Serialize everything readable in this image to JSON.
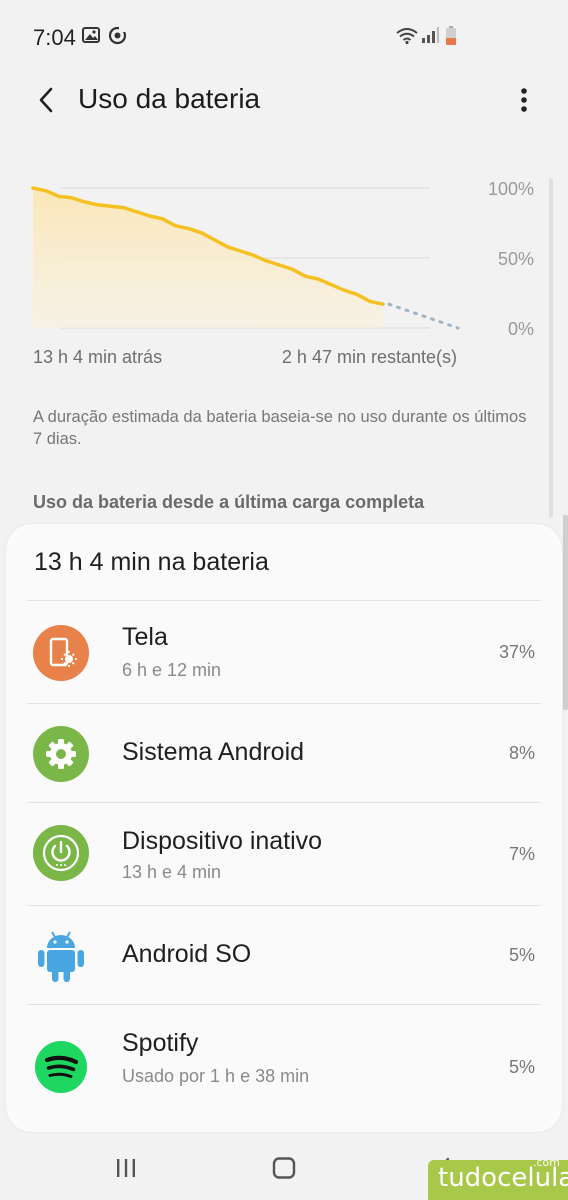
{
  "status_bar": {
    "time": "7:04",
    "icons_left": [
      "image-icon",
      "sync-icon"
    ],
    "icons_right": [
      "wifi-icon",
      "signal-icon",
      "battery-icon"
    ]
  },
  "header": {
    "title": "Uso da bateria",
    "back_icon": "back-arrow-icon",
    "menu_icon": "more-vert-icon"
  },
  "chart_data": {
    "type": "area",
    "y_ticks": [
      "100%",
      "50%",
      "0%"
    ],
    "ylim": [
      0,
      100
    ],
    "x_labels": [
      "13 h 4 min atrás",
      "2 h 47 min restante(s)"
    ],
    "series": [
      {
        "values": [
          100,
          98,
          94,
          93,
          90,
          88,
          87,
          86,
          83,
          80,
          78,
          73,
          71,
          68,
          63,
          58,
          55,
          52,
          48,
          45,
          42,
          37,
          35,
          31,
          27,
          24,
          19,
          17
        ],
        "color": "#f5c021"
      }
    ],
    "projection": {
      "start": 17,
      "end": 0,
      "color": "#9fb4c8",
      "style": "dotted"
    },
    "grid": true
  },
  "estimate_note": "A duração estimada da bateria baseia-se no uso durante os últimos 7 dias.",
  "section_header": "Uso da bateria desde a última carga completa",
  "card": {
    "title": "13 h 4 min na bateria",
    "items": [
      {
        "name": "Tela",
        "sub": "6 h e 12 min",
        "pct": "37%",
        "icon": "screen-brightness-icon",
        "color": "#e8814a"
      },
      {
        "name": "Sistema Android",
        "sub": "",
        "pct": "8%",
        "icon": "gear-icon",
        "color": "#7ab648"
      },
      {
        "name": "Dispositivo inativo",
        "sub": "13 h e 4 min",
        "pct": "7%",
        "icon": "power-icon",
        "color": "#7ab648"
      },
      {
        "name": "Android SO",
        "sub": "",
        "pct": "5%",
        "icon": "android-icon",
        "color": "#4aa6e0"
      },
      {
        "name": "Spotify",
        "sub": "Usado por 1 h e 38 min",
        "pct": "5%",
        "icon": "spotify-icon",
        "color": "#1ed760"
      }
    ]
  },
  "nav": {
    "recent_icon": "recent-apps-icon",
    "home_icon": "home-icon",
    "back_icon": "nav-back-icon"
  },
  "watermark": {
    "text": "tudocelular",
    "suffix": ".com"
  }
}
